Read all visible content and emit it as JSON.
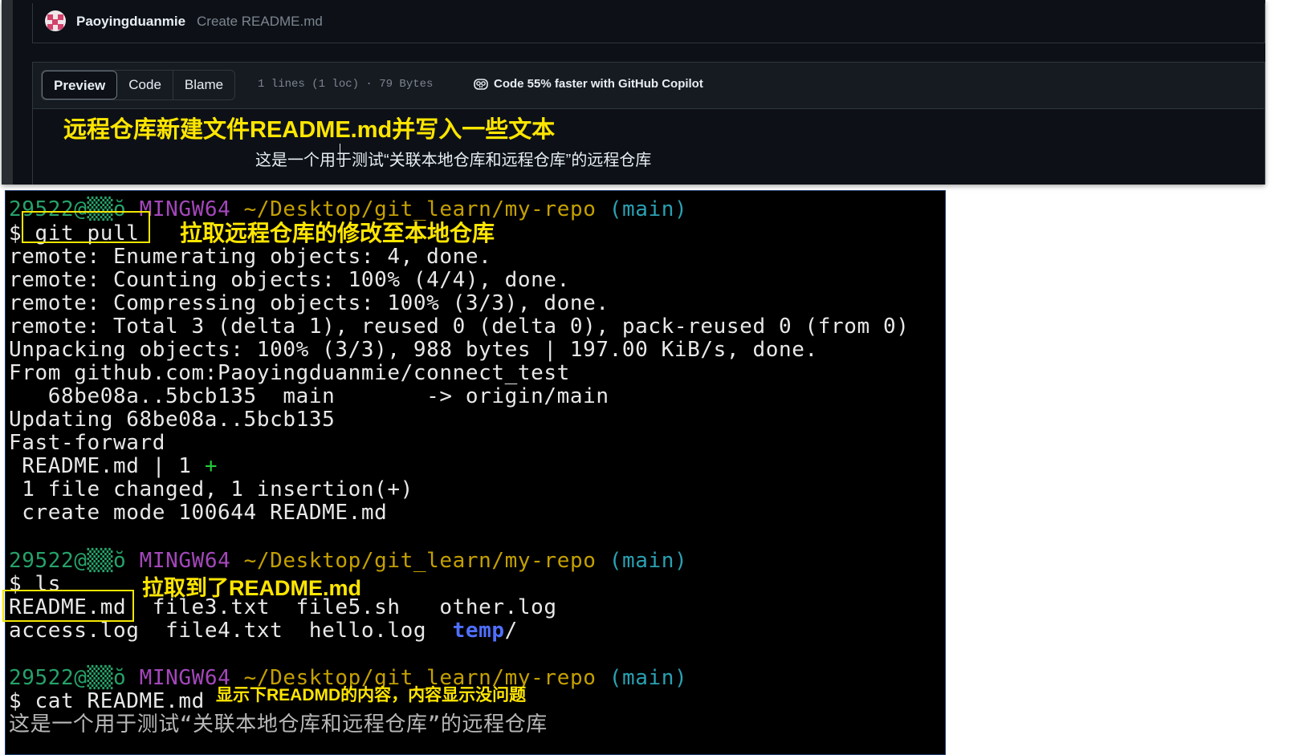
{
  "github": {
    "commit": {
      "author": "Paoyingduanmie",
      "message": "Create README.md"
    },
    "tabs": [
      "Preview",
      "Code",
      "Blame"
    ],
    "active_tab": "Preview",
    "file_meta": "1 lines (1 loc) · 79 Bytes",
    "copilot_text": "Code 55% faster with GitHub Copilot",
    "readme_content": "这是一个用于测试“关联本地仓库和远程仓库”的远程仓库"
  },
  "annotations": {
    "remote_create": "远程仓库新建文件README.md并写入一些文本",
    "git_pull": "拉取远程仓库的修改至本地仓库",
    "ls": "拉取到了README.md",
    "cat": "显示下READMD的内容，内容显示没问题"
  },
  "terminal": {
    "prompt": {
      "user_host": "29522@",
      "host_glyph": "▒▒ŏ",
      "shell": "MINGW64",
      "path": "~/Desktop/git_learn/my-repo",
      "branch": "(main)"
    },
    "cmd1": "git pull",
    "pull_output": [
      "remote: Enumerating objects: 4, done.",
      "remote: Counting objects: 100% (4/4), done.",
      "remote: Compressing objects: 100% (3/3), done.",
      "remote: Total 3 (delta 1), reused 0 (delta 0), pack-reused 0 (from 0)",
      "Unpacking objects: 100% (3/3), 988 bytes | 197.00 KiB/s, done.",
      "From github.com:Paoyingduanmie/connect_test",
      "   68be08a..5bcb135  main       -> origin/main",
      "Updating 68be08a..5bcb135",
      "Fast-forward"
    ],
    "diffstat_file": " README.md | 1 ",
    "diffstat_plus": "+",
    "summary": [
      " 1 file changed, 1 insertion(+)",
      " create mode 100644 README.md"
    ],
    "cmd2": "ls",
    "ls_row1": [
      "README.md",
      "file3.txt",
      "file5.sh",
      "other.log"
    ],
    "ls_row2": [
      "access.log",
      "file4.txt",
      "hello.log"
    ],
    "ls_dir": "temp",
    "ls_dir_slash": "/",
    "cmd3": "cat README.md",
    "cat_output": "这是一个用于测试“关联本地仓库和远程仓库”的远程仓库",
    "dollar": "$"
  },
  "colors": {
    "prompt_green": "#26a269",
    "prompt_magenta": "#a347ba",
    "prompt_yellow": "#c4a000",
    "prompt_cyan": "#2aa1b3",
    "annotation_yellow": "#ffe600",
    "dir_blue": "#4f6fff"
  }
}
